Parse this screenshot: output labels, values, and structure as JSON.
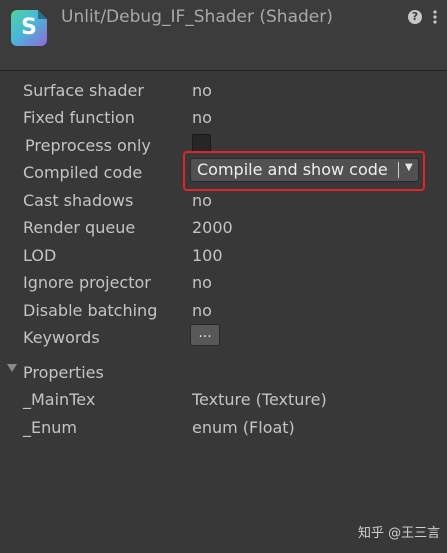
{
  "header": {
    "title": "Unlit/Debug_IF_Shader (Shader)",
    "icon_letter": "S",
    "help_glyph": "?",
    "menu_glyph": "⋮"
  },
  "rows": {
    "surface_shader": {
      "label": "Surface shader",
      "value": "no"
    },
    "fixed_function": {
      "label": "Fixed function",
      "value": "no"
    },
    "preprocess_only": {
      "label": "Preprocess only",
      "checked": false
    },
    "compiled_code": {
      "label": "Compiled code",
      "button": "Compile and show code",
      "arrow": "▼"
    },
    "cast_shadows": {
      "label": "Cast shadows",
      "value": "no"
    },
    "render_queue": {
      "label": "Render queue",
      "value": "2000"
    },
    "lod": {
      "label": "LOD",
      "value": "100"
    },
    "ignore_projector": {
      "label": "Ignore projector",
      "value": "no"
    },
    "disable_batching": {
      "label": "Disable batching",
      "value": "no"
    },
    "keywords": {
      "label": "Keywords",
      "button": "..."
    }
  },
  "properties": {
    "header": "Properties",
    "items": [
      {
        "name": "_MainTex",
        "type": "Texture (Texture)"
      },
      {
        "name": "_Enum",
        "type": "enum (Float)"
      }
    ]
  },
  "watermark": "知乎 @王三言",
  "colors": {
    "background": "#383838",
    "header": "#3c3c3c",
    "highlight": "#e0242a"
  }
}
